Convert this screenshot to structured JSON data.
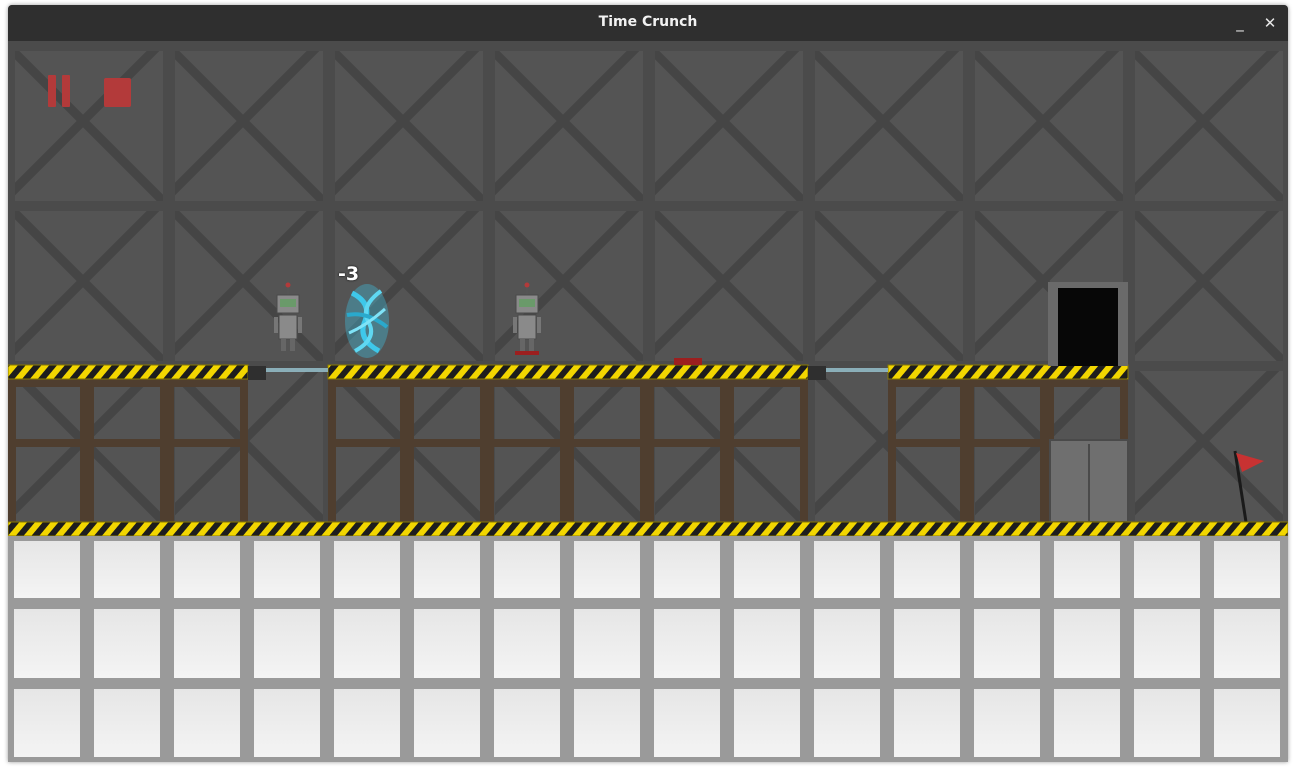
{
  "window": {
    "title": "Time Crunch",
    "minimize_label": "_",
    "close_label": "✕"
  },
  "hud": {
    "pause_icon": "pause-icon",
    "stop_icon": "stop-icon",
    "accent_color": "#b33a3a"
  },
  "level": {
    "time_modifier": "-3",
    "portal_color": "#3ec8ea",
    "hazard_color": "#f2d600",
    "girder_color": "#4f3e2f",
    "flag_color": "#c83232"
  }
}
